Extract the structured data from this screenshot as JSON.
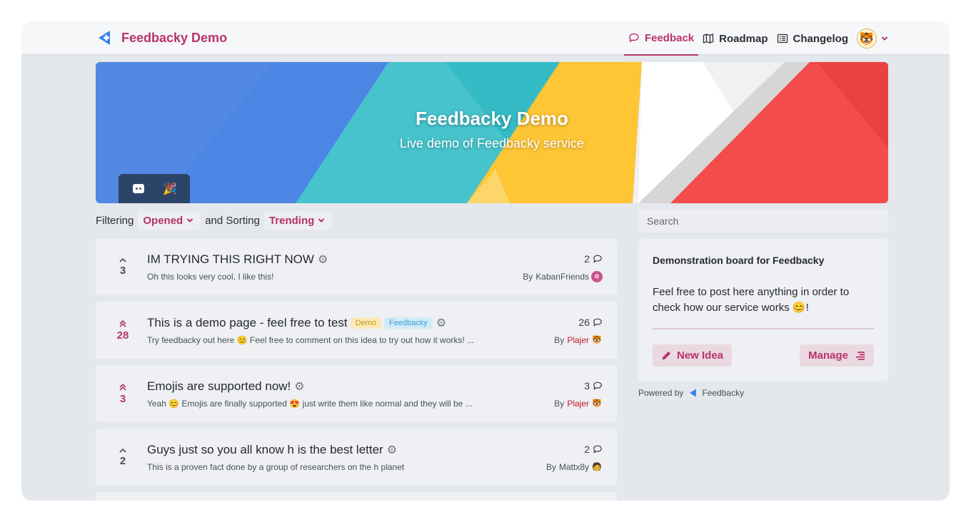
{
  "header": {
    "brand_name": "Feedbacky Demo",
    "nav": [
      {
        "label": "Feedback",
        "icon": "comment-icon",
        "active": true
      },
      {
        "label": "Roadmap",
        "icon": "map-icon",
        "active": false
      },
      {
        "label": "Changelog",
        "icon": "list-icon",
        "active": false
      }
    ]
  },
  "banner": {
    "title": "Feedbacky Demo",
    "subtitle": "Live demo of Feedbacky service",
    "social": [
      "discord-icon",
      "party-icon"
    ]
  },
  "filters": {
    "filtering_label": "Filtering",
    "filter_value": "Opened",
    "sorting_label": "and Sorting",
    "sort_value": "Trending"
  },
  "posts": [
    {
      "votes": "3",
      "upvoted": false,
      "title": "IM TRYING THIS RIGHT NOW",
      "tags": [],
      "description": "Oh this looks very cool, I like this!",
      "comments": "2",
      "by": "By",
      "author": "KabanFriends",
      "author_highlight": false
    },
    {
      "votes": "28",
      "upvoted": true,
      "title": "This is a demo page - feel free to test",
      "tags": [
        "Demo",
        "Feedbacky"
      ],
      "description": "Try feedbacky out here 😊 Feel free to comment on this idea to try out how it works! ...",
      "comments": "26",
      "by": "By",
      "author": "Plajer",
      "author_highlight": true
    },
    {
      "votes": "3",
      "upvoted": true,
      "title": "Emojis are supported now!",
      "tags": [],
      "description": "Yeah 😊 Emojis are finally supported 😍 just write them like normal and they will be ...",
      "comments": "3",
      "by": "By",
      "author": "Plajer",
      "author_highlight": true
    },
    {
      "votes": "2",
      "upvoted": false,
      "title": "Guys just so you all know h is the best letter",
      "tags": [],
      "description": "This is a proven fact done by a group of researchers on the h planet",
      "comments": "2",
      "by": "By",
      "author": "Mattx8y",
      "author_highlight": false
    }
  ],
  "sidebar": {
    "search_placeholder": "Search",
    "board_title": "Demonstration board for Feedbacky",
    "board_description_a": "Feel free to post here anything in order to check how our service works ",
    "board_description_emoji": "😊",
    "board_description_b": "!",
    "new_idea_label": "New Idea",
    "manage_label": "Manage",
    "powered_by": "Powered by",
    "powered_brand": "Feedbacky"
  },
  "colors": {
    "accent": "#b8336a",
    "page_bg": "#e4e7eb",
    "card_bg": "#eef0f3",
    "author_red": "#c0182c"
  }
}
